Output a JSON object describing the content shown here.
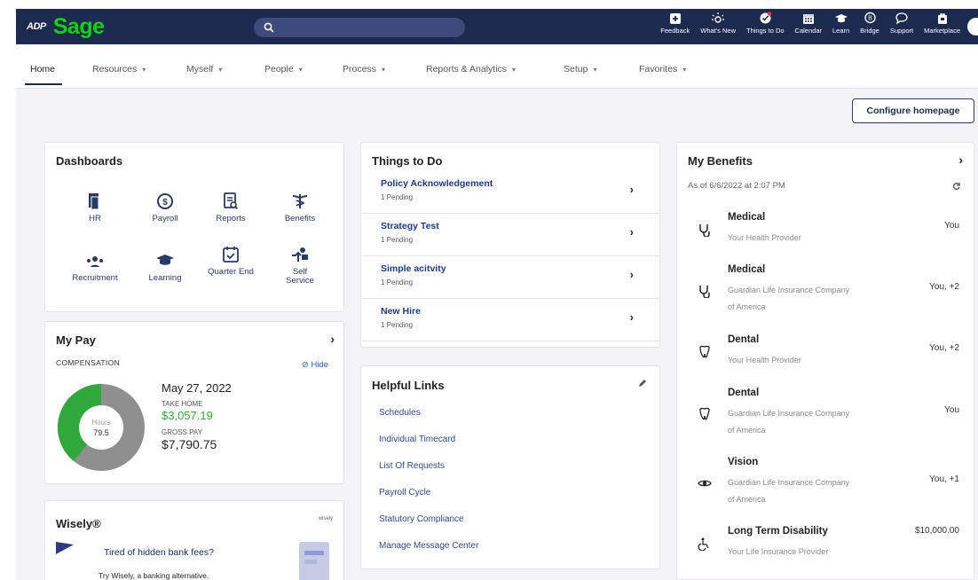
{
  "brand": {
    "adp": "ADP",
    "sage": "Sage"
  },
  "toolbar": {
    "items": [
      {
        "label": "Feedback",
        "icon": "feedback-icon"
      },
      {
        "label": "What's New",
        "icon": "lightbulb-icon"
      },
      {
        "label": "Things to Do",
        "icon": "todo-check-icon"
      },
      {
        "label": "Calendar",
        "icon": "calendar-icon"
      },
      {
        "label": "Learn",
        "icon": "graduation-cap-icon"
      },
      {
        "label": "Bridge",
        "icon": "bridge-icon"
      },
      {
        "label": "Support",
        "icon": "chat-bubble-icon"
      },
      {
        "label": "Marketplace",
        "icon": "marketplace-icon"
      }
    ]
  },
  "nav": {
    "items": [
      "Home",
      "Resources",
      "Myself",
      "People",
      "Process",
      "Reports & Analytics",
      "Setup",
      "Favorites"
    ],
    "active": "Home"
  },
  "configure_label": "Configure homepage",
  "dashboards": {
    "title": "Dashboards",
    "items": [
      {
        "label": "HR",
        "icon": "hr-document-icon"
      },
      {
        "label": "Payroll",
        "icon": "payroll-dollar-icon"
      },
      {
        "label": "Reports",
        "icon": "reports-icon"
      },
      {
        "label": "Benefits",
        "icon": "benefits-caduceus-icon"
      },
      {
        "label": "Recruitment",
        "icon": "recruitment-icon"
      },
      {
        "label": "Learning",
        "icon": "learning-cap-icon"
      },
      {
        "label": "Quarter End",
        "icon": "calendar-check-icon"
      },
      {
        "label": "Self Service",
        "icon": "self-service-icon"
      }
    ]
  },
  "my_pay": {
    "title": "My Pay",
    "compensation_label": "COMPENSATION",
    "hide_label": "Hide",
    "date": "May 27, 2022",
    "take_home_label": "TAKE HOME",
    "take_home": "$3,057.19",
    "gross_label": "GROSS PAY",
    "gross": "$7,790.75",
    "hours_label": "Hours",
    "hours": "79.5",
    "donut_fraction": 0.39,
    "colors": {
      "take_home": "#30a93a",
      "other": "#8f8f8f"
    }
  },
  "wisely": {
    "title": "Wisely®",
    "logo": "wisely",
    "headline": "Tired of hidden bank fees?",
    "body": "Try Wisely, a banking alternative."
  },
  "things_to_do": {
    "title": "Things to Do",
    "items": [
      {
        "title": "Policy Acknowledgement",
        "status": "1 Pending"
      },
      {
        "title": "Strategy Test",
        "status": "1 Pending"
      },
      {
        "title": "Simple acitvity",
        "status": "1 Pending"
      },
      {
        "title": "New Hire",
        "status": "1 Pending"
      }
    ]
  },
  "helpful_links": {
    "title": "Helpful Links",
    "items": [
      "Schedules",
      "Individual Timecard",
      "List Of Requests",
      "Payroll Cycle",
      "Statutory Compliance",
      "Manage Message Center"
    ]
  },
  "my_benefits": {
    "title": "My Benefits",
    "as_of": "As of 6/6/2022 at 2:07 PM",
    "items": [
      {
        "name": "Medical",
        "provider": "Your Health Provider",
        "who": "You",
        "icon": "medical-stethoscope-icon"
      },
      {
        "name": "Medical",
        "provider": "Guardian Life Insurance Company of America",
        "who": "You, +2",
        "icon": "medical-stethoscope-icon"
      },
      {
        "name": "Dental",
        "provider": "Your Health Provider",
        "who": "You, +2",
        "icon": "tooth-icon"
      },
      {
        "name": "Dental",
        "provider": "Guardian Life Insurance Company of America",
        "who": "You",
        "icon": "tooth-icon"
      },
      {
        "name": "Vision",
        "provider": "Guardian Life Insurance Company of America",
        "who": "You, +1",
        "icon": "eye-icon"
      },
      {
        "name": "Long Term Disability",
        "provider": "Your Life Insurance Provider",
        "who": "$10,000.00",
        "icon": "disability-icon"
      }
    ]
  }
}
